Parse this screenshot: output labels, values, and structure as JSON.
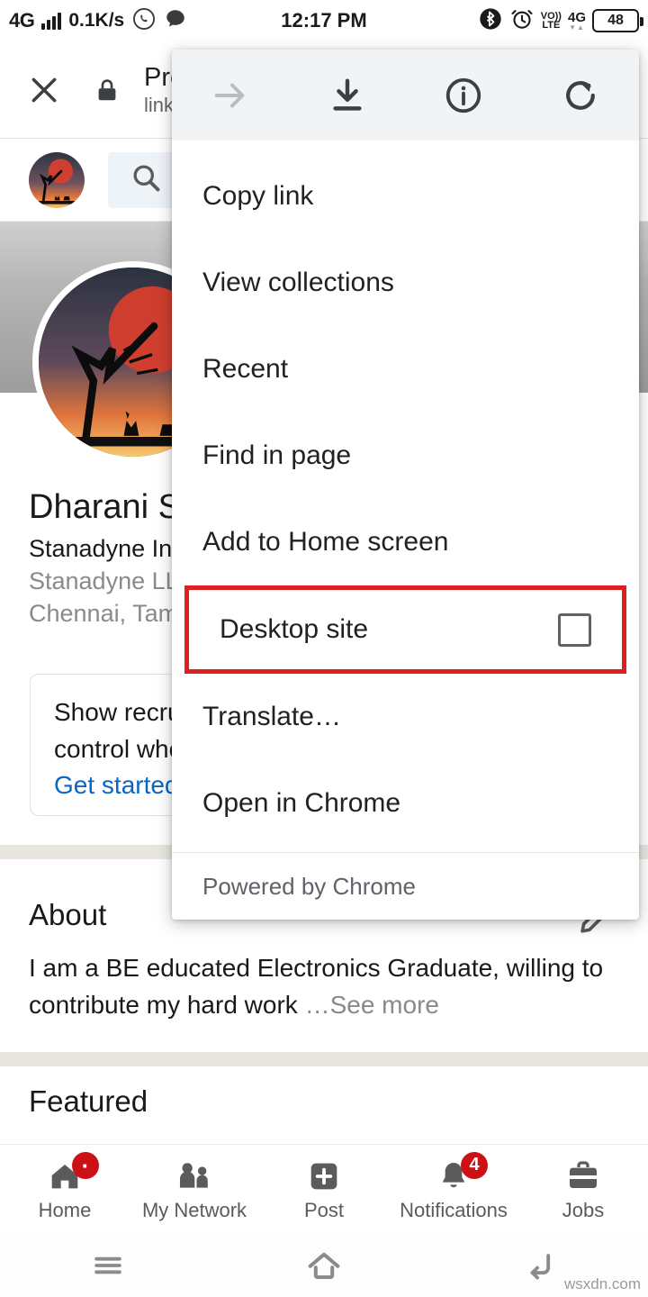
{
  "status_bar": {
    "network_type": "4G",
    "data_speed": "0.1K/s",
    "whatsapp_icon": "whatsapp-icon",
    "message_icon": "message-bubble-icon",
    "time": "12:17 PM",
    "bluetooth_icon": "bluetooth-icon",
    "alarm_icon": "alarm-clock-icon",
    "volte_top": "VO))",
    "volte_bottom": "LTE",
    "network_type_right": "4G",
    "battery_level": "48"
  },
  "browser_bar": {
    "close_icon": "close-icon",
    "lock_icon": "lock-icon",
    "page_title": "Pro",
    "page_host": "linke"
  },
  "app_header": {
    "avatar": "user-avatar",
    "search_icon": "search-icon"
  },
  "profile": {
    "name": "Dharani S",
    "headline": "Stanadyne In",
    "company": "Stanadyne LL",
    "location": "Chennai, Tam",
    "recruiter_card": {
      "line1": "Show recru",
      "line2": "control who",
      "link": "Get started"
    }
  },
  "about": {
    "title": "About",
    "edit_icon": "pencil-edit-icon",
    "text": "I am a BE educated Electronics Graduate, willing to contribute my hard work",
    "see_more": "…See more"
  },
  "featured": {
    "title": "Featured"
  },
  "chrome_menu": {
    "toolbar": [
      {
        "name": "forward-arrow-icon",
        "label": "Forward",
        "disabled": true
      },
      {
        "name": "download-icon",
        "label": "Download",
        "disabled": false
      },
      {
        "name": "page-info-icon",
        "label": "Page info",
        "disabled": false
      },
      {
        "name": "reload-icon",
        "label": "Reload",
        "disabled": false
      }
    ],
    "items": [
      {
        "label": "Copy link",
        "checkbox": false,
        "highlighted": false
      },
      {
        "label": "View collections",
        "checkbox": false,
        "highlighted": false
      },
      {
        "label": "Recent",
        "checkbox": false,
        "highlighted": false
      },
      {
        "label": "Find in page",
        "checkbox": false,
        "highlighted": false
      },
      {
        "label": "Add to Home screen",
        "checkbox": false,
        "highlighted": false
      },
      {
        "label": "Desktop site",
        "checkbox": true,
        "checked": false,
        "highlighted": true
      },
      {
        "label": "Translate…",
        "checkbox": false,
        "highlighted": false
      },
      {
        "label": "Open in Chrome",
        "checkbox": false,
        "highlighted": false
      }
    ],
    "footer": "Powered by Chrome",
    "highlight_color": "#e02020"
  },
  "bottom_nav": [
    {
      "label": "Home",
      "icon": "home-icon",
      "badge": "·",
      "badge_type": "dot"
    },
    {
      "label": "My Network",
      "icon": "people-icon",
      "badge": "",
      "badge_type": "none"
    },
    {
      "label": "Post",
      "icon": "plus-square-icon",
      "badge": "",
      "badge_type": "none"
    },
    {
      "label": "Notifications",
      "icon": "bell-icon",
      "badge": "4",
      "badge_type": "count"
    },
    {
      "label": "Jobs",
      "icon": "briefcase-icon",
      "badge": "",
      "badge_type": "none"
    }
  ],
  "android_nav": {
    "menu_icon": "hamburger-menu-icon",
    "home_icon": "home-outline-icon",
    "back_icon": "back-arrow-icon"
  },
  "watermark": "wsxdn.com"
}
